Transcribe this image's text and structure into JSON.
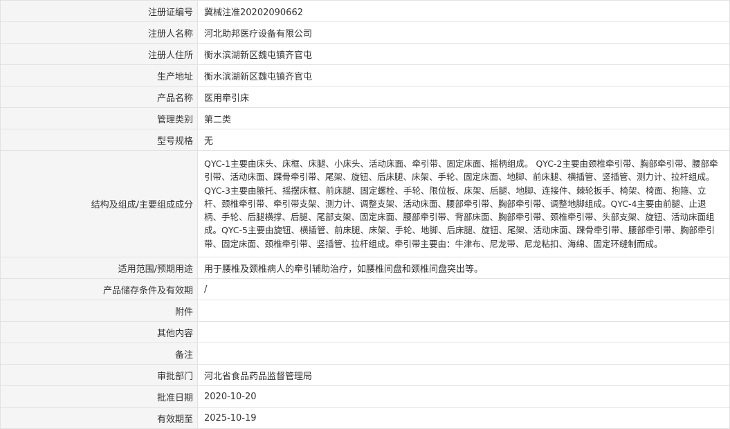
{
  "rows": [
    {
      "label": "注册证编号",
      "value": "冀械注准20202090662"
    },
    {
      "label": "注册人名称",
      "value": "河北助邦医疗设备有限公司"
    },
    {
      "label": "注册人住所",
      "value": "衡水滨湖新区魏屯镇齐官屯"
    },
    {
      "label": "生产地址",
      "value": "衡水滨湖新区魏屯镇齐官屯"
    },
    {
      "label": "产品名称",
      "value": "医用牵引床"
    },
    {
      "label": "管理类别",
      "value": "第二类"
    },
    {
      "label": "型号规格",
      "value": "无"
    },
    {
      "label": "结构及组成/主要组成成分",
      "value": "QYC-1主要由床头、床框、床腿、小床头、活动床面、牵引带、固定床面、摇柄组成。 QYC-2主要由颈椎牵引带、胸部牵引带、腰部牵引带、活动床面、踝骨牵引带、尾架、旋钮、后床腿、床架、手轮、固定床面、地脚、前床腿、横插管、竖插管、测力计、拉杆组成。QYC-3主要由腋托、摇摆床框、前床腿、固定螺栓、手轮、限位板、床架、后腿、地脚、连接件、棘轮扳手、椅架、椅面、抱箍、立杆、颈椎牵引带、牵引带支架、测力计、调整支架、活动床面、腰部牵引带、胸部牵引带、调整地脚组成。QYC-4主要由前腿、止退柄、手轮、后腿横撑、后腿、尾部支架、固定床面、腰部牵引带、背部床面、胸部牵引带、颈椎牵引带、头部支架、旋钮、活动床面组成。QYC-5主要由旋钮、横插管、前床腿、床架、手轮、地脚、后床腿、旋钮、尾架、活动床面、踝骨牵引带、腰部牵引带、胸部牵引带、固定床面、颈椎牵引带、竖插管、拉杆组成。牵引带主要由：牛津布、尼龙带、尼龙粘扣、海绵、固定环缝制而成。"
    },
    {
      "label": "适用范围/预期用途",
      "value": "用于腰椎及颈椎病人的牵引辅助治疗，如腰椎间盘和颈椎间盘突出等。"
    },
    {
      "label": "产品储存条件及有效期",
      "value": "/"
    },
    {
      "label": "附件",
      "value": ""
    },
    {
      "label": "其他内容",
      "value": ""
    },
    {
      "label": "备注",
      "value": ""
    },
    {
      "label": "审批部门",
      "value": "河北省食品药品监督管理局"
    },
    {
      "label": "批准日期",
      "value": "2020-10-20"
    },
    {
      "label": "有效期至",
      "value": "2025-10-19"
    }
  ]
}
